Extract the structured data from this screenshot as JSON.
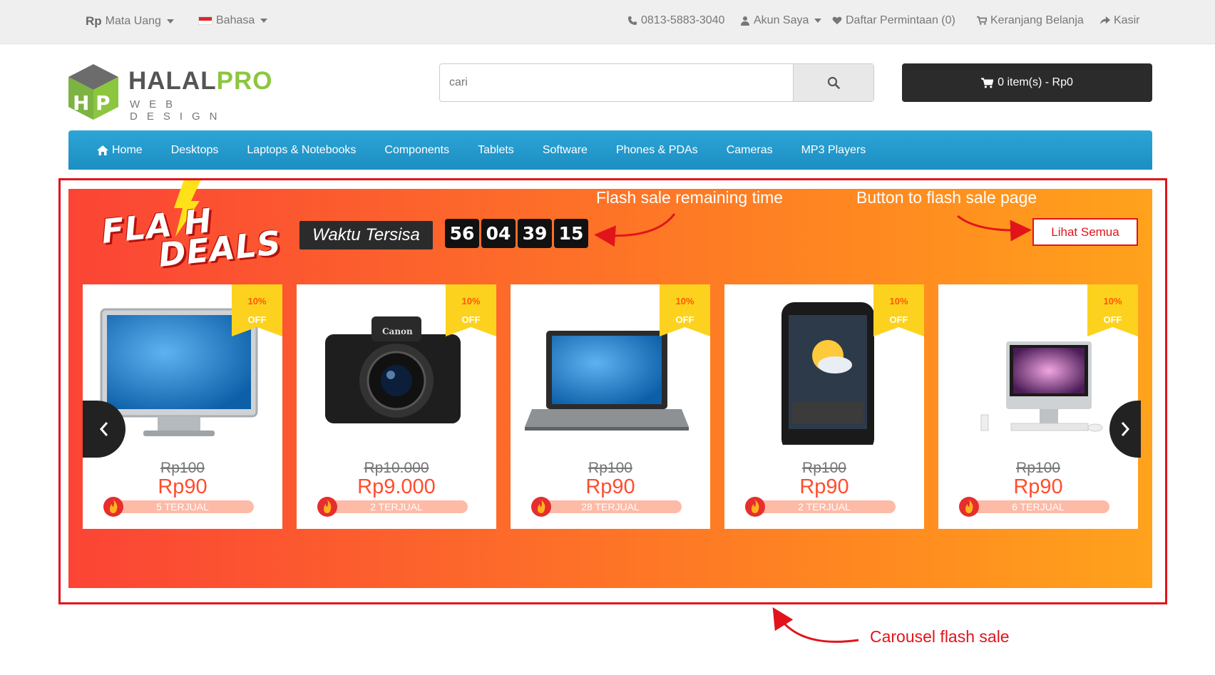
{
  "topbar": {
    "currency_symbol": "Rp",
    "currency_label": "Mata Uang",
    "language_label": "Bahasa",
    "phone": "0813-5883-3040",
    "account": "Akun Saya",
    "wishlist": "Daftar Permintaan (0)",
    "cart": "Keranjang Belanja",
    "checkout": "Kasir"
  },
  "logo": {
    "brand_a": "HALAL",
    "brand_b": "PRO",
    "tagline": "WEB DESIGN"
  },
  "search": {
    "placeholder": "cari"
  },
  "cart_button": {
    "label": "0 item(s) - Rp0"
  },
  "nav": {
    "items": [
      {
        "label": "Home"
      },
      {
        "label": "Desktops"
      },
      {
        "label": "Laptops & Notebooks"
      },
      {
        "label": "Components"
      },
      {
        "label": "Tablets"
      },
      {
        "label": "Software"
      },
      {
        "label": "Phones & PDAs"
      },
      {
        "label": "Cameras"
      },
      {
        "label": "MP3 Players"
      }
    ]
  },
  "flash": {
    "logo_line1": "FLA H",
    "logo_line2": "DEALS",
    "remaining_label": "Waktu Tersisa",
    "timer": [
      "56",
      "04",
      "39",
      "15"
    ],
    "see_all": "Lihat Semua",
    "products": [
      {
        "name": "monitor",
        "badge_pct": "10%",
        "badge_off": "OFF",
        "old_price": "Rp100",
        "price": "Rp90",
        "sold": "5 TERJUAL"
      },
      {
        "name": "camera",
        "badge_pct": "10%",
        "badge_off": "OFF",
        "old_price": "Rp10.000",
        "price": "Rp9.000",
        "sold": "2 TERJUAL"
      },
      {
        "name": "laptop",
        "badge_pct": "10%",
        "badge_off": "OFF",
        "old_price": "Rp100",
        "price": "Rp90",
        "sold": "28 TERJUAL"
      },
      {
        "name": "phone",
        "badge_pct": "10%",
        "badge_off": "OFF",
        "old_price": "Rp100",
        "price": "Rp90",
        "sold": "2 TERJUAL"
      },
      {
        "name": "imac",
        "badge_pct": "10%",
        "badge_off": "OFF",
        "old_price": "Rp100",
        "price": "Rp90",
        "sold": "6 TERJUAL"
      }
    ]
  },
  "annotations": {
    "timer_note": "Flash sale remaining time",
    "button_note": "Button to flash sale page",
    "carousel_note": "Carousel flash sale"
  },
  "colors": {
    "accent_red": "#e1141c",
    "nav_blue": "#2da5d6",
    "price": "#ff4d2d",
    "badge": "#fcd21f"
  }
}
